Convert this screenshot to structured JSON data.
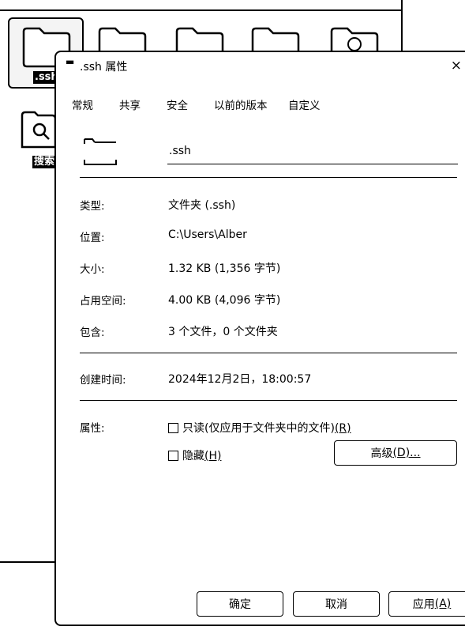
{
  "background": {
    "selected_label": ".ssh",
    "search_label": "搜索"
  },
  "dialog": {
    "title": ".ssh 属性",
    "close_glyph": "×",
    "tabs": [
      "常规",
      "共享",
      "安全",
      "以前的版本",
      "自定义"
    ],
    "name_value": ".ssh",
    "properties": {
      "type_label": "类型:",
      "type_value": "文件夹 (.ssh)",
      "location_label": "位置:",
      "location_value": "C:\\Users\\Alber",
      "size_label": "大小:",
      "size_value": "1.32 KB (1,356 字节)",
      "size_on_disk_label": "占用空间:",
      "size_on_disk_value": "4.00 KB (4,096 字节)",
      "contains_label": "包含:",
      "contains_value": "3 个文件，0 个文件夹",
      "created_label": "创建时间:",
      "created_value": "2024年12月2日，18:00:57",
      "attributes_label": "属性:"
    },
    "attributes": {
      "readonly_text": "只读(仅应用于文件夹中的文件)",
      "readonly_key": "(R)",
      "readonly_checked": false,
      "hidden_text": "隐藏",
      "hidden_key": "(H)",
      "hidden_checked": false,
      "advanced_text": "高级",
      "advanced_key": "(D)...",
      "advanced_full": "高级(D)..."
    },
    "buttons": {
      "ok": "确定",
      "cancel": "取消",
      "apply_text": "应用",
      "apply_key": "(A)"
    }
  }
}
